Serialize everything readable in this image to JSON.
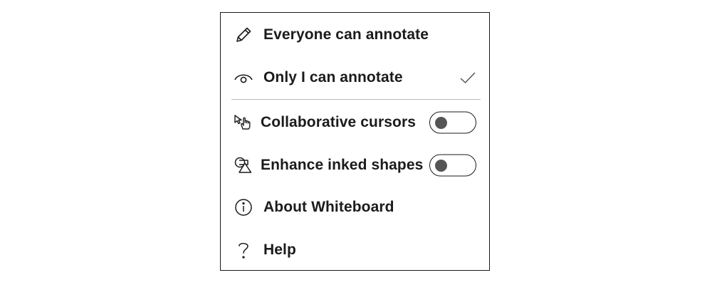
{
  "menu": {
    "items": [
      {
        "id": "everyone",
        "label": "Everyone can annotate",
        "icon": "pencil-icon"
      },
      {
        "id": "only-me",
        "label": "Only I can annotate",
        "icon": "eye-icon",
        "checked": true,
        "check_icon": "checkmark-icon"
      },
      {
        "id": "cursors",
        "label": "Collaborative cursors",
        "icon": "hand-cursor-icon",
        "toggle": false
      },
      {
        "id": "shapes",
        "label": "Enhance inked shapes",
        "icon": "shapes-icon",
        "toggle": false
      },
      {
        "id": "about",
        "label": "About Whiteboard",
        "icon": "info-icon"
      },
      {
        "id": "help",
        "label": "Help",
        "icon": "question-mark-icon"
      }
    ]
  },
  "colors": {
    "text": "#1b1b1b",
    "border": "#1a1a1a",
    "divider": "#b9b9b9",
    "toggle_knob_off": "#555555",
    "background": "#ffffff"
  }
}
